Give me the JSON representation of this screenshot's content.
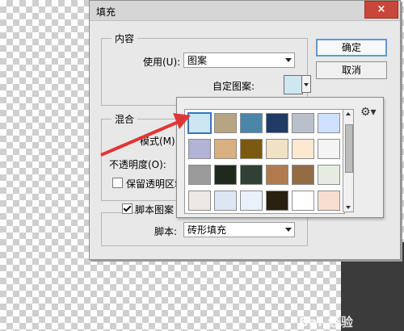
{
  "dialog": {
    "title": "填充",
    "close_label": "×",
    "content_group": "内容",
    "use_label": "使用(U):",
    "use_value": "图案",
    "custom_pattern_label": "自定图案:",
    "blend_group": "混合",
    "mode_label": "模式(M):",
    "opacity_label": "不透明度(O):",
    "preserve_label": "保留透明区域",
    "script_pattern_label": "脚本图案",
    "script_pattern_checked": true,
    "script_label": "脚本:",
    "script_value": "砖形填充",
    "ok_label": "确定",
    "cancel_label": "取消"
  },
  "picker": {
    "gear_icon": "gear-icon",
    "selected_index": 0,
    "swatch_colors": [
      "#cde7f0",
      "#b7a582",
      "#4b86a8",
      "#1f3b66",
      "#b8c1cb",
      "#cfe0ff",
      "#b3b3d6",
      "#d9b082",
      "#7a5910",
      "#f1e2c5",
      "#fde9d2",
      "#f4f4f4",
      "#9b9b9b",
      "#1e2a1c",
      "#304034",
      "#b17b4e",
      "#936c44",
      "#e6ecdf",
      "#ece8e4",
      "#dde6f4",
      "#eaf1fb",
      "#2a2010",
      "#ffffff",
      "#f6dfd0"
    ]
  },
  "page": {
    "watermark": "Bai 经验"
  },
  "colors": {
    "accent": "#3a73c2",
    "arrow": "#e23535",
    "close": "#c9473a"
  }
}
